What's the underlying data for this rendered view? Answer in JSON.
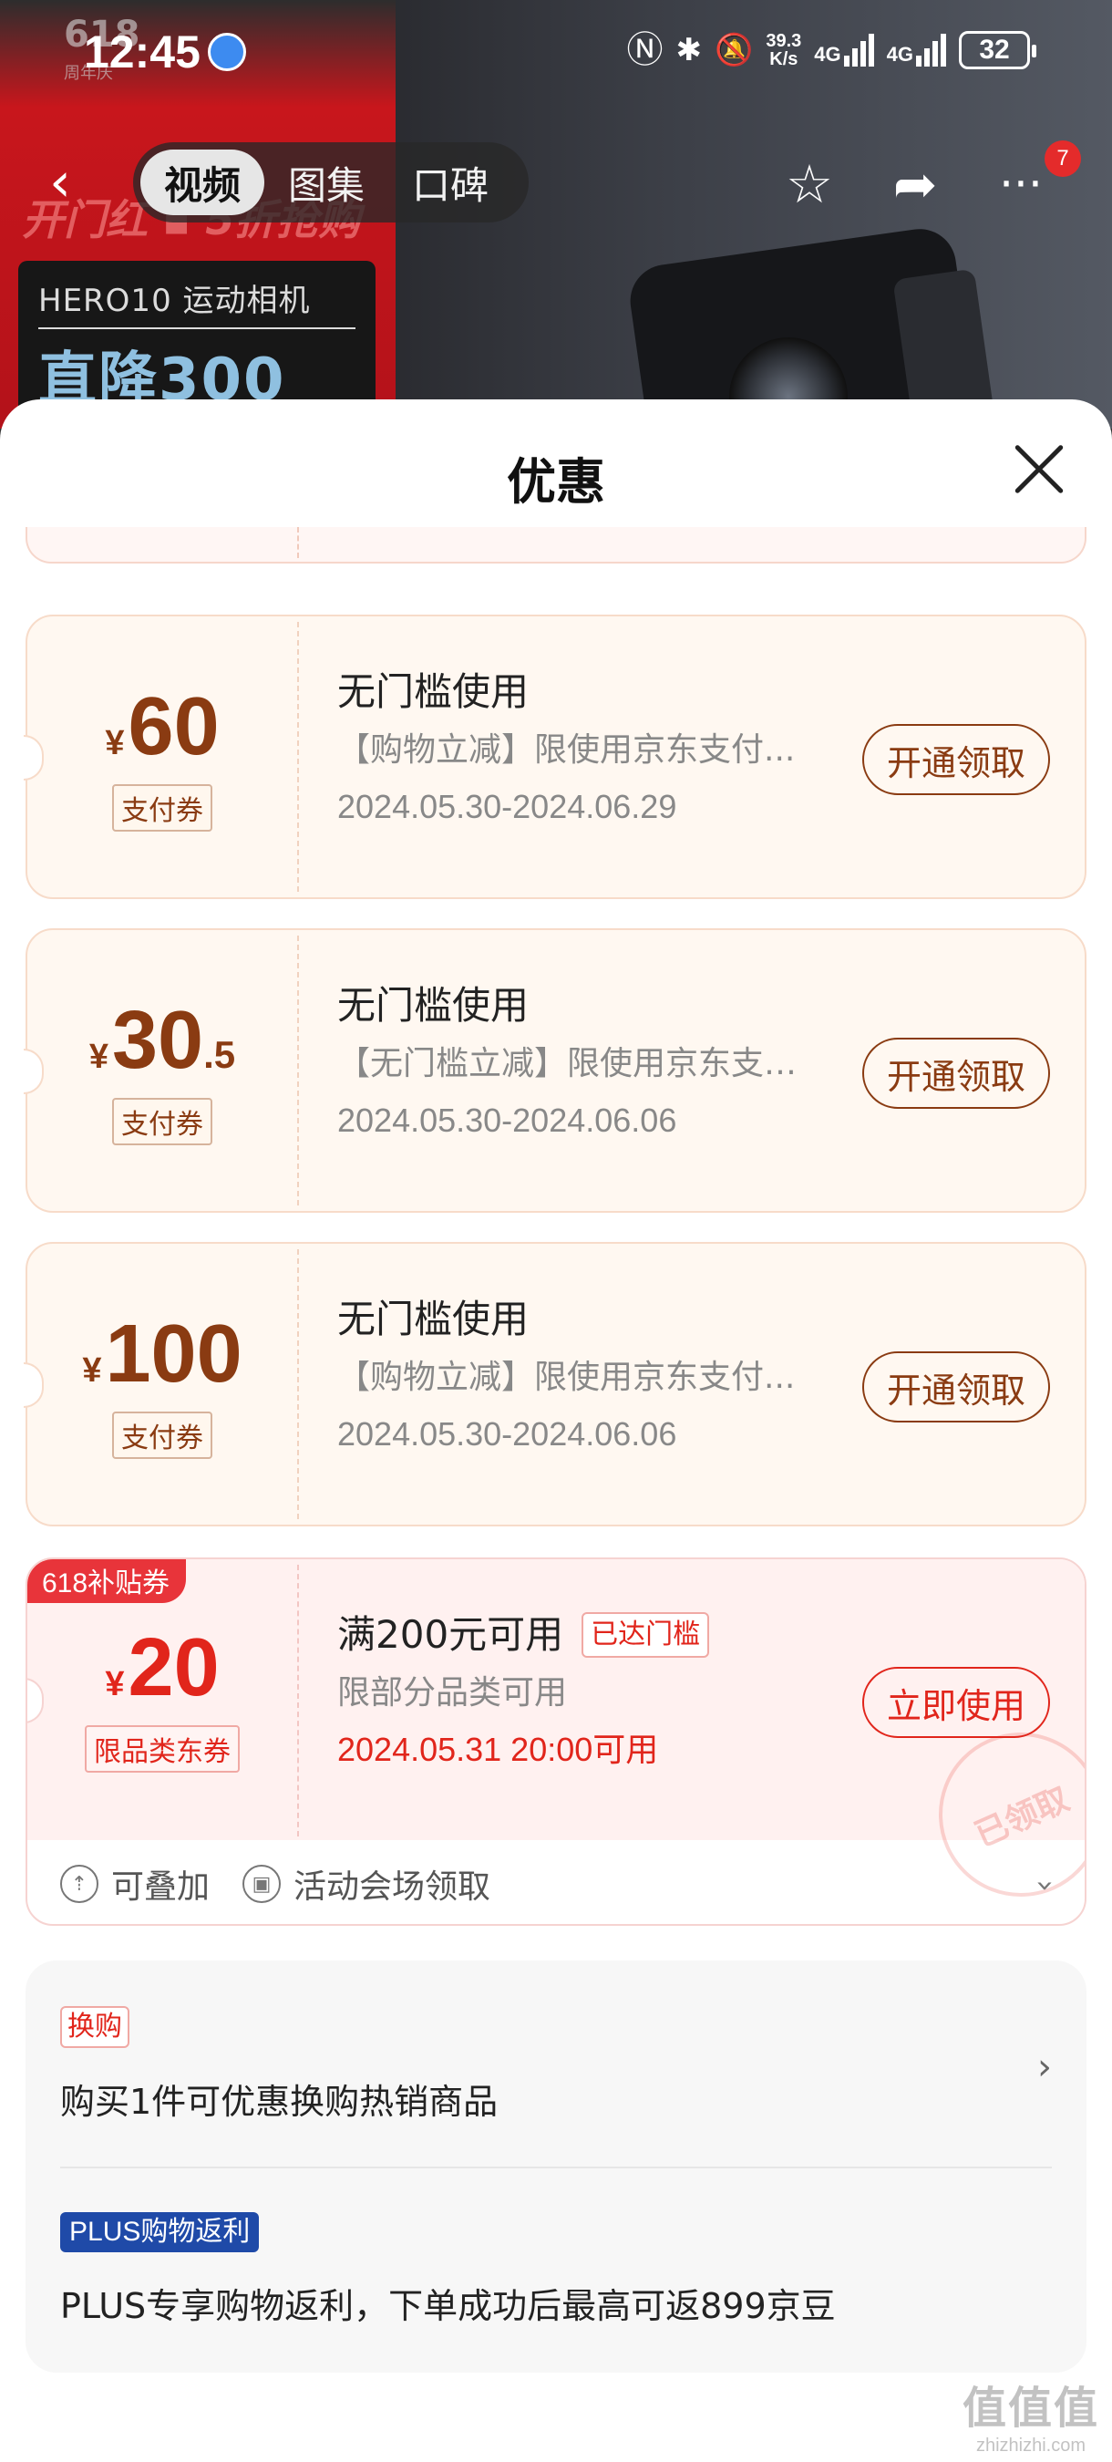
{
  "status_bar": {
    "time": "12:45",
    "net_speed_top": "39.3",
    "net_speed_bottom": "K/s",
    "sig1": "4G",
    "sig2": "4G",
    "battery": "32"
  },
  "background_promo": {
    "badge_618": "618",
    "badge_sub": "周年庆",
    "headline": "开门红 ▪ 5折抢购",
    "model": "HERO10 运动相机",
    "drop": "直降300"
  },
  "nav": {
    "tabs": [
      {
        "label": "视频",
        "active": true
      },
      {
        "label": "图集",
        "active": false
      },
      {
        "label": "口碑",
        "active": false
      }
    ],
    "badge": "7"
  },
  "sheet": {
    "title": "优惠",
    "coupons": [
      {
        "yen": "¥",
        "amount_int": "60",
        "amount_dec": "",
        "tag": "支付券",
        "title": "无门槛使用",
        "desc": "【购物立减】限使用京东支付...",
        "date": "2024.05.30-2024.06.29",
        "button": "开通领取"
      },
      {
        "yen": "¥",
        "amount_int": "30",
        "amount_dec": ".5",
        "tag": "支付券",
        "title": "无门槛使用",
        "desc": "【无门槛立减】限使用京东支付...",
        "date": "2024.05.30-2024.06.06",
        "button": "开通领取"
      },
      {
        "yen": "¥",
        "amount_int": "100",
        "amount_dec": "",
        "tag": "支付券",
        "title": "无门槛使用",
        "desc": "【购物立减】限使用京东支付...",
        "date": "2024.05.30-2024.06.06",
        "button": "开通领取"
      }
    ],
    "red_coupon": {
      "ribbon": "618补贴券",
      "yen": "¥",
      "amount": "20",
      "tag": "限品类东券",
      "title": "满200元可用",
      "badge": "已达门槛",
      "desc": "限部分品类可用",
      "date": "2024.05.31 20:00可用",
      "button": "立即使用",
      "stamp": "已领取",
      "footer_stackable": "可叠加",
      "footer_venue": "活动会场领取"
    },
    "info": {
      "exchange_tag": "换购",
      "exchange_text": "购买1件可优惠换购热销商品",
      "plus_tag": "PLUS购物返利",
      "plus_text": "PLUS专享购物返利，下单成功后最高可返899京豆"
    }
  },
  "watermark": {
    "logo": "值值值",
    "url": "zhizhizhi.com"
  }
}
